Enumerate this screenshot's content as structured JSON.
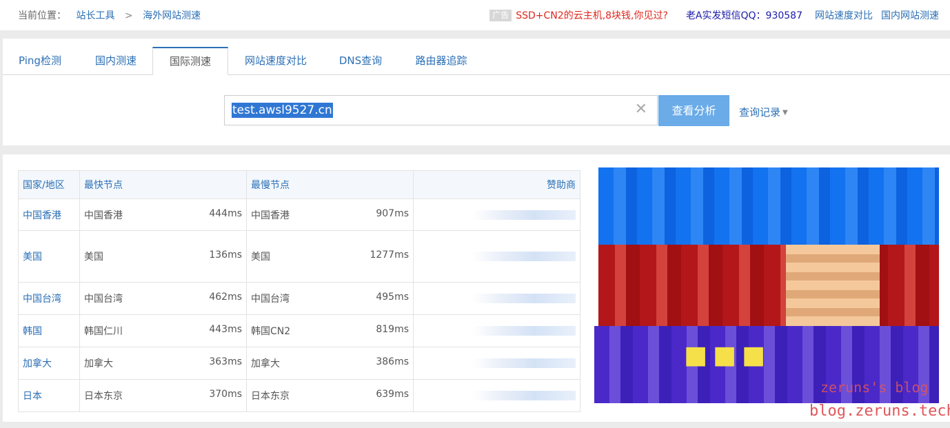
{
  "breadcrumb": {
    "prefix": "当前位置：",
    "items": [
      "站长工具",
      "海外网站测速"
    ],
    "separator": ">"
  },
  "topbar": {
    "ad_tag": "广告",
    "ad_text": "SSD+CN2的云主机,8块钱,你见过?",
    "qq_text": "老A实发短信QQ：930587",
    "links": [
      "网站速度对比",
      "国内网站测速"
    ]
  },
  "tabs": [
    "Ping检测",
    "国内测速",
    "国际测速",
    "网站速度对比",
    "DNS查询",
    "路由器追踪"
  ],
  "active_tab": "国际测速",
  "search": {
    "value": "test.awsl9527.cn",
    "button": "查看分析",
    "history": "查询记录"
  },
  "table": {
    "headers": [
      "国家/地区",
      "最快节点",
      "最慢节点",
      "赞助商"
    ],
    "rows": [
      {
        "country": "中国香港",
        "fast_node": "中国香港",
        "fast_ms": "444ms",
        "slow_node": "中国香港",
        "slow_ms": "907ms"
      },
      {
        "country": "美国",
        "fast_node": "美国",
        "fast_ms": "136ms",
        "slow_node": "美国",
        "slow_ms": "1277ms"
      },
      {
        "country": "中国台湾",
        "fast_node": "中国台湾",
        "fast_ms": "462ms",
        "slow_node": "中国台湾",
        "slow_ms": "495ms"
      },
      {
        "country": "韩国",
        "fast_node": "韩国仁川",
        "fast_ms": "443ms",
        "slow_node": "韩国CN2",
        "slow_ms": "819ms"
      },
      {
        "country": "加拿大",
        "fast_node": "加拿大",
        "fast_ms": "363ms",
        "slow_node": "加拿大",
        "slow_ms": "386ms"
      },
      {
        "country": "日本",
        "fast_node": "日本东京",
        "fast_ms": "370ms",
        "slow_node": "日本东京",
        "slow_ms": "639ms"
      }
    ]
  },
  "watermark": {
    "line1": "zeruns's blog",
    "line2": "blog.zeruns.tech"
  },
  "colors": {
    "link": "#2b6fb5",
    "ad": "#e0261c",
    "button": "#6aabe8",
    "watermark": "#e0565a"
  }
}
